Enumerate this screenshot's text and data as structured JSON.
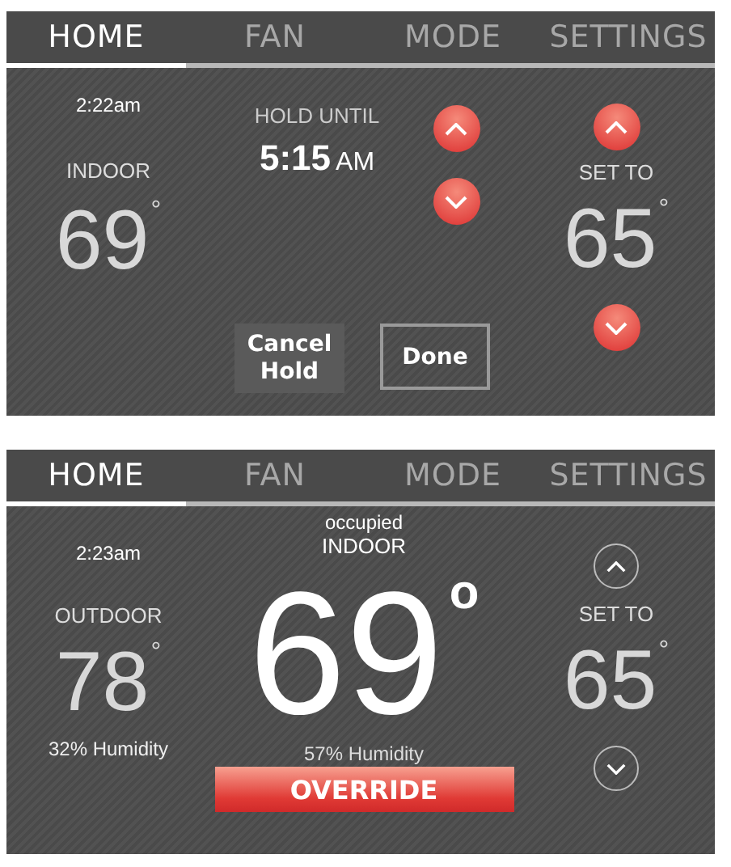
{
  "screens": [
    {
      "kind": "hold",
      "tabs": [
        {
          "label": "HOME",
          "selected": true
        },
        {
          "label": "FAN",
          "selected": false
        },
        {
          "label": "MODE",
          "selected": false
        },
        {
          "label": "SETTINGS",
          "selected": false
        }
      ],
      "time": "2:22am",
      "temp_label": "INDOOR",
      "temp": "69",
      "temp_degree": "°",
      "hold_label": "HOLD UNTIL",
      "hold_time": "5:15",
      "hold_ampm": "AM",
      "setpoint_label": "SET TO",
      "setpoint": "65",
      "setpoint_degree": "°",
      "buttons": [
        "Cancel Hold",
        "Done"
      ]
    },
    {
      "kind": "home",
      "tabs": [
        {
          "label": "HOME",
          "selected": true
        },
        {
          "label": "FAN",
          "selected": false
        },
        {
          "label": "MODE",
          "selected": false
        },
        {
          "label": "SETTINGS",
          "selected": false
        }
      ],
      "time": "2:23am",
      "outdoor_label": "OUTDOOR",
      "outdoor_temp": "78",
      "outdoor_degree": "°",
      "outdoor_humidity": "32% Humidity",
      "status": "occupied",
      "indoor_label": "INDOOR",
      "indoor_temp": "69",
      "indoor_degree": "o",
      "indoor_humidity": "57% Humidity",
      "override": "OVERRIDE",
      "setpoint_label": "SET TO",
      "setpoint": "65",
      "setpoint_degree": "°"
    }
  ]
}
